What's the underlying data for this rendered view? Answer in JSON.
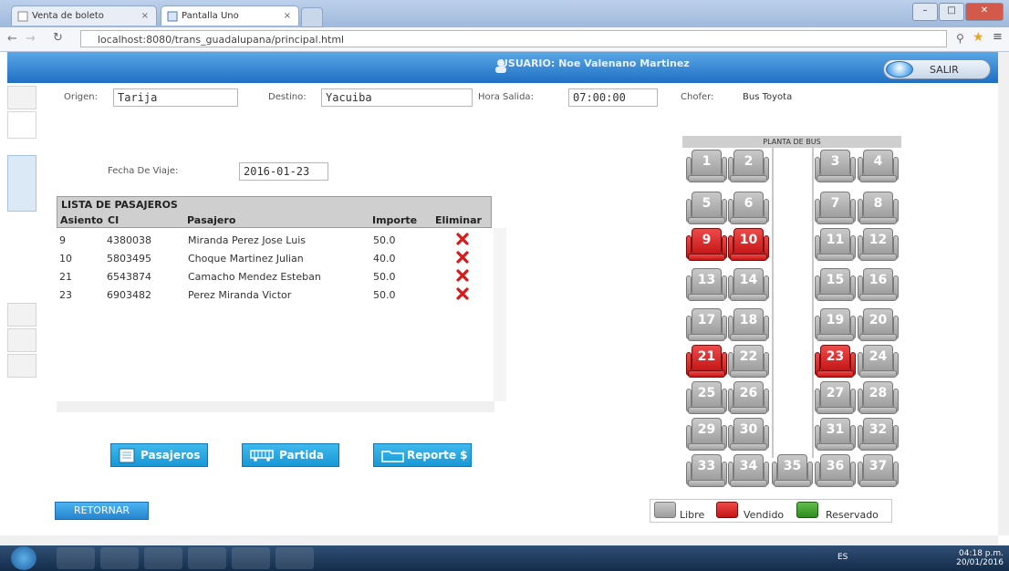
{
  "browser": {
    "tabs": [
      {
        "label": "Venta de boleto"
      },
      {
        "label": "Pantalla Uno"
      }
    ],
    "url": "localhost:8080/trans_guadalupana/principal.html",
    "controls": {
      "min": "–",
      "max": "□",
      "close": "✕"
    }
  },
  "header": {
    "user_text": "USUARIO: Noe Valenano Martinez",
    "salir_label": "SALIR"
  },
  "form": {
    "origen_label": "Origen:",
    "origen_value": "Tarija",
    "destino_label": "Destino:",
    "destino_value": "Yacuiba",
    "hora_label": "Hora Salida:",
    "hora_value": "07:00:00",
    "chofer_label": "Chofer:",
    "chofer_value": "Bus Toyota",
    "fecha_label": "Fecha De Viaje:",
    "fecha_value": "2016-01-23"
  },
  "passengers": {
    "title": "LISTA DE PASAJEROS",
    "columns": [
      "Asiento",
      "CI",
      "Pasajero",
      "Importe",
      "Eliminar"
    ],
    "rows": [
      {
        "asiento": "9",
        "ci": "4380038",
        "pasajero": "Miranda Perez Jose Luis",
        "importe": "50.0"
      },
      {
        "asiento": "10",
        "ci": "5803495",
        "pasajero": "Choque Martinez Julian",
        "importe": "40.0"
      },
      {
        "asiento": "21",
        "ci": "6543874",
        "pasajero": "Camacho Mendez Esteban",
        "importe": "50.0"
      },
      {
        "asiento": "23",
        "ci": "6903482",
        "pasajero": "Perez Miranda Victor",
        "importe": "50.0"
      }
    ]
  },
  "actions": {
    "pasajeros_label": "Pasajeros",
    "partida_label": "Partida",
    "reporte_label": "Reporte $",
    "retornar_label": "RETORNAR"
  },
  "bus": {
    "title": "PLANTA DE BUS",
    "seats": [
      {
        "n": "1",
        "status": "libre"
      },
      {
        "n": "2",
        "status": "libre"
      },
      {
        "n": "3",
        "status": "libre"
      },
      {
        "n": "4",
        "status": "libre"
      },
      {
        "n": "5",
        "status": "libre"
      },
      {
        "n": "6",
        "status": "libre"
      },
      {
        "n": "7",
        "status": "libre"
      },
      {
        "n": "8",
        "status": "libre"
      },
      {
        "n": "9",
        "status": "vendido"
      },
      {
        "n": "10",
        "status": "vendido"
      },
      {
        "n": "11",
        "status": "libre"
      },
      {
        "n": "12",
        "status": "libre"
      },
      {
        "n": "13",
        "status": "libre"
      },
      {
        "n": "14",
        "status": "libre"
      },
      {
        "n": "15",
        "status": "libre"
      },
      {
        "n": "16",
        "status": "libre"
      },
      {
        "n": "17",
        "status": "libre"
      },
      {
        "n": "18",
        "status": "libre"
      },
      {
        "n": "19",
        "status": "libre"
      },
      {
        "n": "20",
        "status": "libre"
      },
      {
        "n": "21",
        "status": "vendido"
      },
      {
        "n": "22",
        "status": "libre"
      },
      {
        "n": "23",
        "status": "vendido"
      },
      {
        "n": "24",
        "status": "libre"
      },
      {
        "n": "25",
        "status": "libre"
      },
      {
        "n": "26",
        "status": "libre"
      },
      {
        "n": "27",
        "status": "libre"
      },
      {
        "n": "28",
        "status": "libre"
      },
      {
        "n": "29",
        "status": "libre"
      },
      {
        "n": "30",
        "status": "libre"
      },
      {
        "n": "31",
        "status": "libre"
      },
      {
        "n": "32",
        "status": "libre"
      },
      {
        "n": "33",
        "status": "libre"
      },
      {
        "n": "34",
        "status": "libre"
      },
      {
        "n": "35",
        "status": "libre"
      },
      {
        "n": "36",
        "status": "libre"
      },
      {
        "n": "37",
        "status": "libre"
      }
    ],
    "legend": {
      "libre": "Libre",
      "vendido": "Vendido",
      "reservado": "Reservado"
    }
  },
  "colors": {
    "libre": "#aaaaaa",
    "vendido": "#d81e1e",
    "reservado": "#3a9a2a",
    "accent": "#1f8fd6"
  },
  "taskbar": {
    "lang": "ES",
    "time": "04:18 p.m.",
    "date": "20/01/2016"
  }
}
